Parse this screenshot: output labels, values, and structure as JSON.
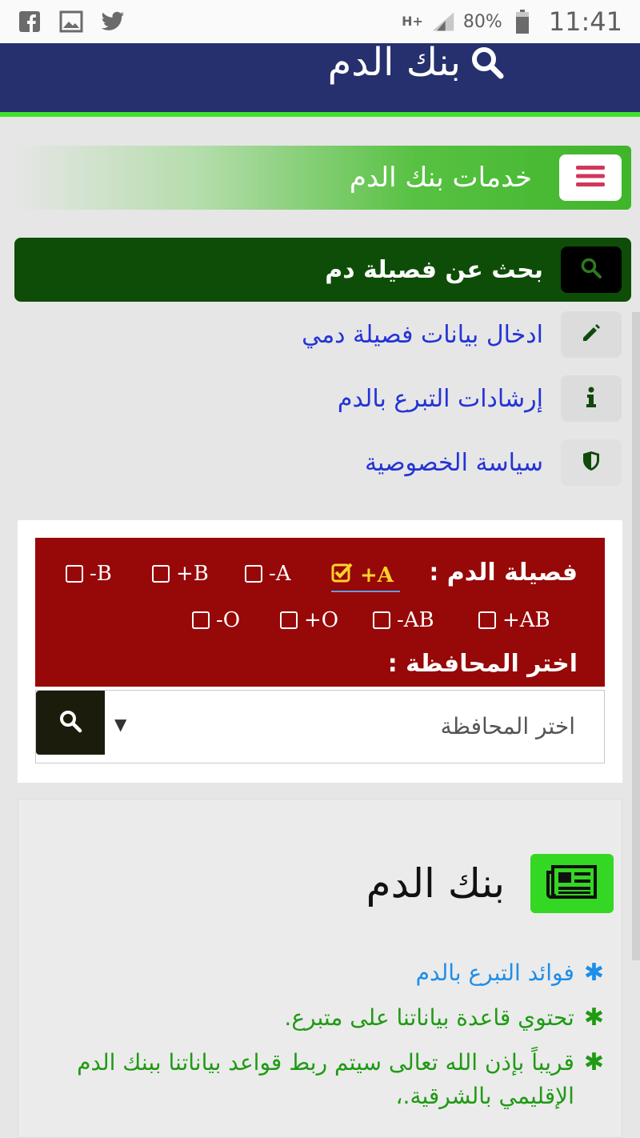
{
  "status_bar": {
    "time": "11:41",
    "battery": "80%",
    "network": "H+",
    "icons": [
      "facebook-icon",
      "gallery-icon",
      "twitter-icon",
      "signal-icon",
      "battery-icon"
    ]
  },
  "header": {
    "title": "بنك الدم"
  },
  "services": {
    "title": "خدمات بنك الدم"
  },
  "nav": {
    "search": "بحث عن فصيلة دم",
    "enter_data": "ادخال بيانات فصيلة دمي",
    "guidelines": "إرشادات التبرع بالدم",
    "privacy": "سياسة الخصوصية"
  },
  "filter": {
    "blood_type_label": "فصيلة الدم :",
    "blood_types": [
      {
        "label": "+A",
        "checked": true
      },
      {
        "label": "-A",
        "checked": false
      },
      {
        "label": "+B",
        "checked": false
      },
      {
        "label": "-B",
        "checked": false
      },
      {
        "label": "+AB",
        "checked": false
      },
      {
        "label": "-AB",
        "checked": false
      },
      {
        "label": "+O",
        "checked": false
      },
      {
        "label": "-O",
        "checked": false
      }
    ],
    "governorate_label": "اختر المحافظة :",
    "governorate_placeholder": "اختر المحافظة"
  },
  "news": {
    "title": "بنك الدم",
    "items": [
      "فوائد التبرع بالدم",
      "تحتوي قاعدة بياناتنا على متبرع.",
      "قريباً بإذن الله تعالى سيتم ربط قواعد بياناتنا ببنك الدم الإقليمي بالشرقية.،"
    ]
  },
  "colors": {
    "header_bg": "#26306e",
    "header_accent": "#3ee22a",
    "nav_active": "#0e4d07",
    "filter_panel": "#970808",
    "selected_option": "#ffd22b",
    "news_icon_bg": "#34d723",
    "link_blue": "#2433d6",
    "text_green": "#1f9a13"
  }
}
